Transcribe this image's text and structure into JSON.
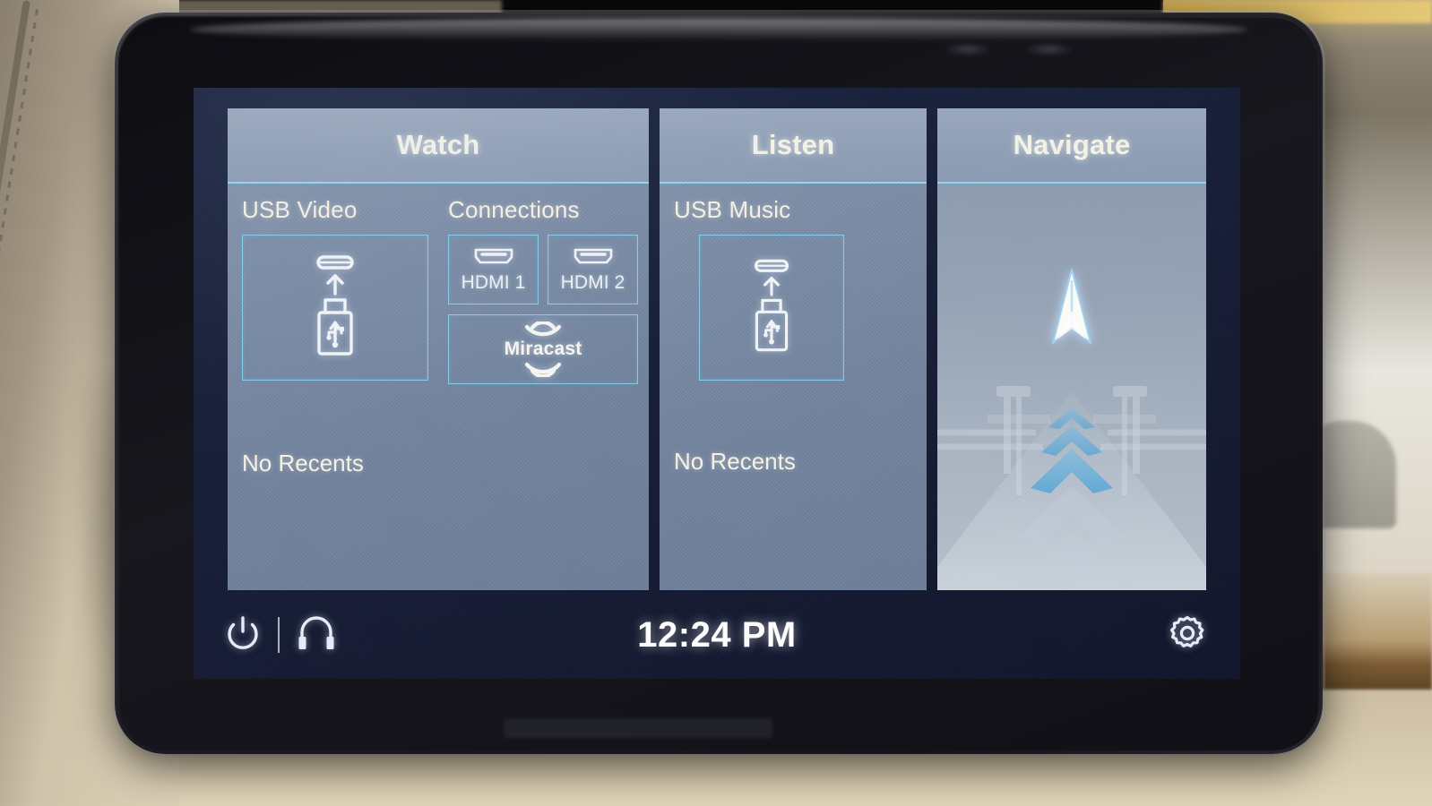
{
  "device": {
    "type": "rear-seat-entertainment-display",
    "screen_time": "12:24 PM"
  },
  "panels": [
    {
      "id": "watch",
      "title": "Watch",
      "sections": [
        {
          "label": "USB Video",
          "tiles": [
            {
              "label": "",
              "icon": "usb-drive-insert-icon"
            }
          ]
        },
        {
          "label": "Connections",
          "tiles": [
            {
              "label": "HDMI 1",
              "icon": "hdmi-port-icon"
            },
            {
              "label": "HDMI 2",
              "icon": "hdmi-port-icon"
            },
            {
              "label": "Miracast",
              "icon": "miracast-icon"
            }
          ]
        }
      ],
      "recents_text": "No Recents"
    },
    {
      "id": "listen",
      "title": "Listen",
      "sections": [
        {
          "label": "USB Music",
          "tiles": [
            {
              "label": "",
              "icon": "usb-drive-insert-icon"
            }
          ]
        }
      ],
      "recents_text": "No Recents"
    },
    {
      "id": "navigate",
      "title": "Navigate",
      "sections": [],
      "recents_text": ""
    }
  ],
  "watch": {
    "title": "Watch",
    "usb_video_label": "USB Video",
    "connections_label": "Connections",
    "hdmi1_label": "HDMI 1",
    "hdmi2_label": "HDMI 2",
    "miracast_label": "Miracast",
    "no_recents": "No Recents"
  },
  "listen": {
    "title": "Listen",
    "usb_music_label": "USB Music",
    "no_recents": "No Recents"
  },
  "navigate": {
    "title": "Navigate"
  },
  "bottom_bar": {
    "power_icon": "power-icon",
    "headphones_icon": "headphones-icon",
    "clock": "12:24 PM",
    "settings_icon": "gear-icon"
  },
  "colors": {
    "panel_bg": "#7b8ca6",
    "panel_header_bg": "#90a0b7",
    "accent_cyan": "#8fd6f0",
    "screen_bg": "#18203a",
    "title_text": "#f4f3e8",
    "label_text": "#f6f2e4",
    "tile_label_text": "#ecf3f8",
    "clock_text": "#ffffff",
    "bezel": "#191920"
  }
}
